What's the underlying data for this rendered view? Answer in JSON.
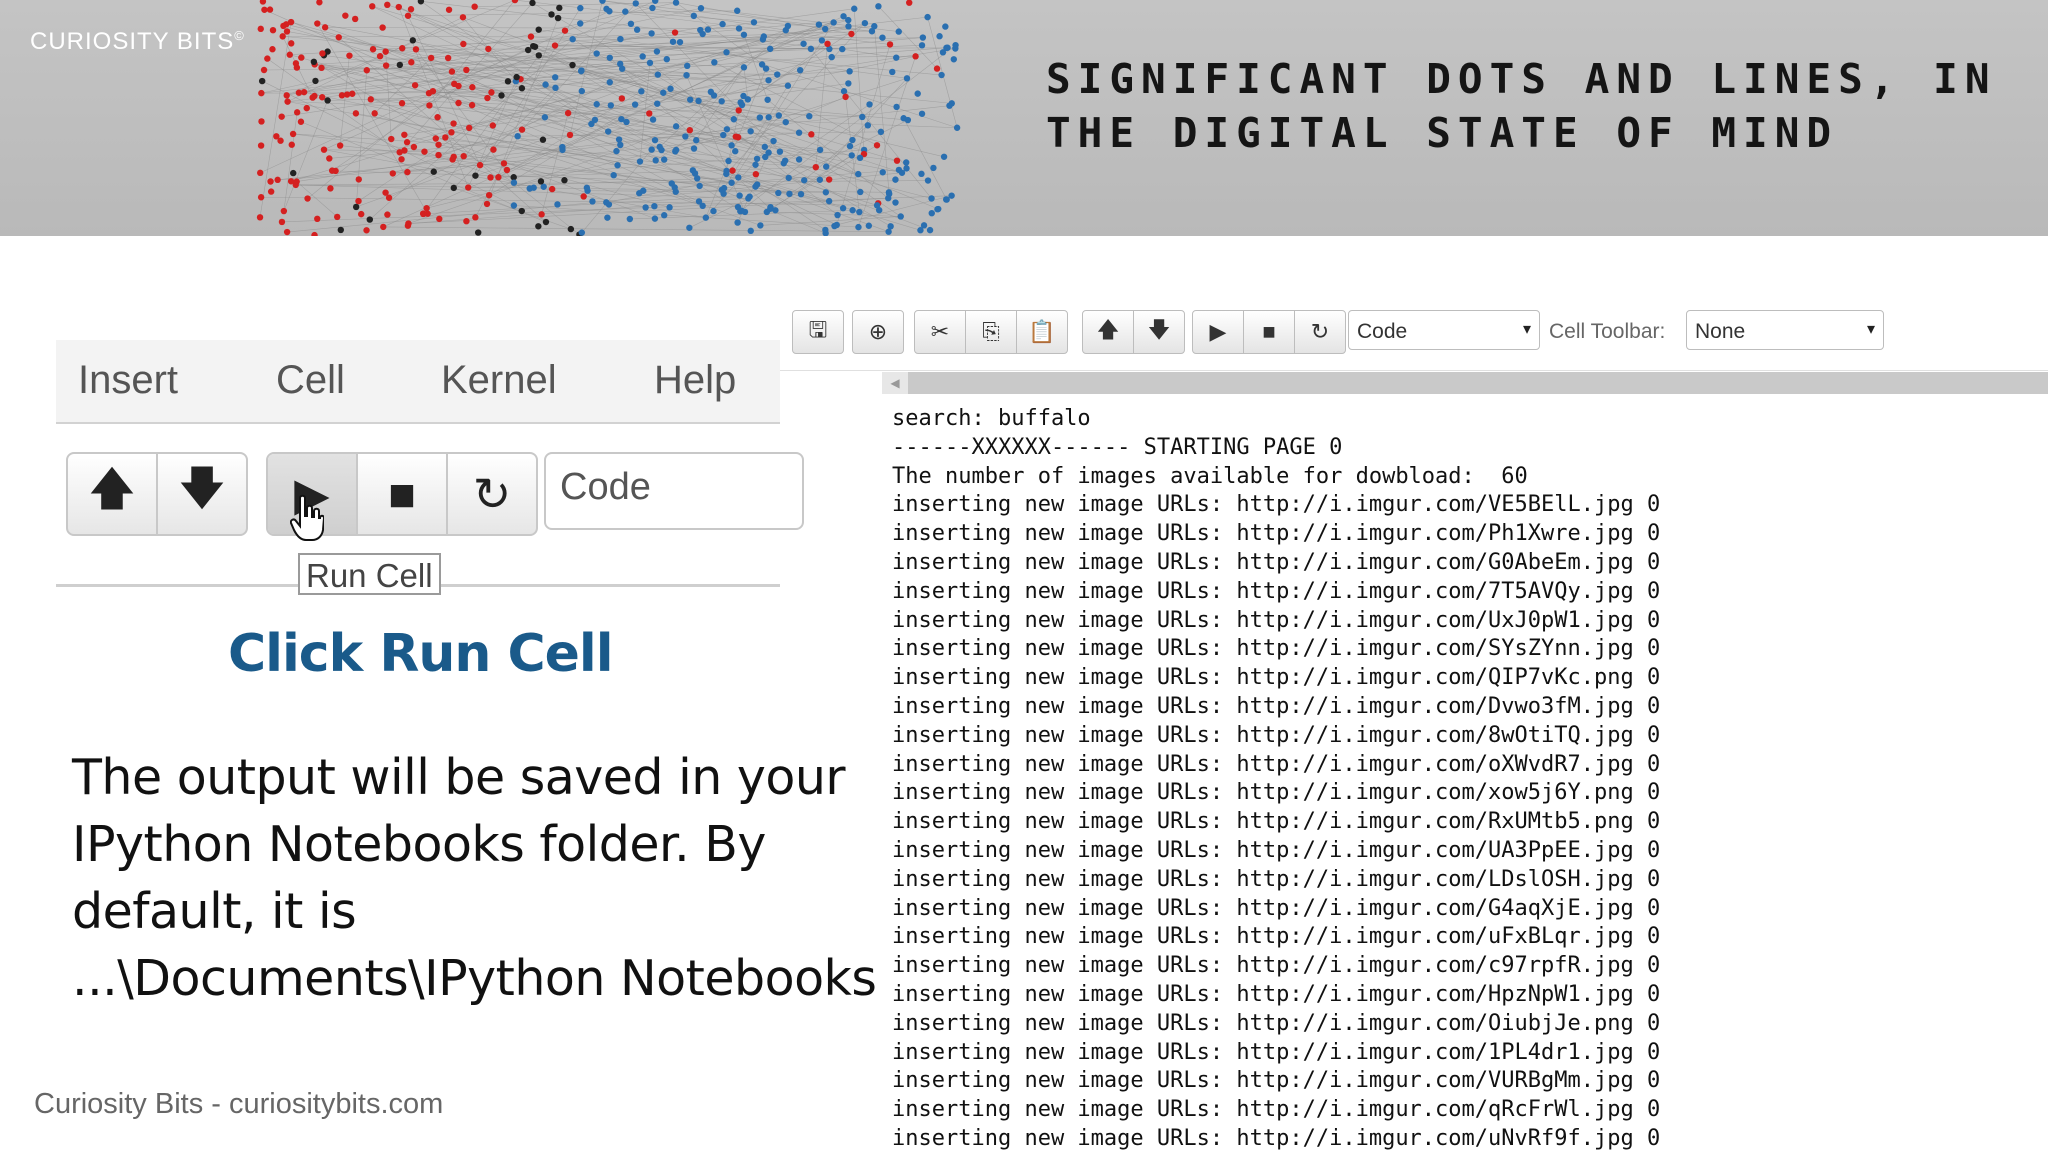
{
  "banner": {
    "brand": "CURIOSITY BITS",
    "brand_mark": "©",
    "tagline_line1": "SIGNIFICANT DOTS AND LINES, IN",
    "tagline_line2": "THE DIGITAL STATE OF MIND"
  },
  "zoom_menu": {
    "items": [
      "Insert",
      "Cell",
      "Kernel",
      "Help"
    ]
  },
  "zoom_toolbar": {
    "cell_type": "Code",
    "tooltip": "Run Cell"
  },
  "instructions": {
    "heading": "Click Run Cell",
    "line1": "The output will be saved in your",
    "line2": "IPython Notebooks folder. By",
    "line3": "default, it is",
    "line4": "...\\Documents\\IPython Notebooks"
  },
  "footer": "Curiosity Bits - curiositybits.com",
  "notebook_toolbar": {
    "cell_type": "Code",
    "cell_toolbar_label": "Cell Toolbar:",
    "cell_toolbar_value": "None"
  },
  "output_lines": [
    "search: buffalo",
    "------XXXXXX------ STARTING PAGE 0",
    "The number of images available for dowbload:  60",
    "inserting new image URLs: http://i.imgur.com/VE5BElL.jpg 0",
    "inserting new image URLs: http://i.imgur.com/Ph1Xwre.jpg 0",
    "inserting new image URLs: http://i.imgur.com/G0AbeEm.jpg 0",
    "inserting new image URLs: http://i.imgur.com/7T5AVQy.jpg 0",
    "inserting new image URLs: http://i.imgur.com/UxJ0pW1.jpg 0",
    "inserting new image URLs: http://i.imgur.com/SYsZYnn.jpg 0",
    "inserting new image URLs: http://i.imgur.com/QIP7vKc.png 0",
    "inserting new image URLs: http://i.imgur.com/Dvwo3fM.jpg 0",
    "inserting new image URLs: http://i.imgur.com/8wOtiTQ.jpg 0",
    "inserting new image URLs: http://i.imgur.com/oXWvdR7.jpg 0",
    "inserting new image URLs: http://i.imgur.com/xow5j6Y.png 0",
    "inserting new image URLs: http://i.imgur.com/RxUMtb5.png 0",
    "inserting new image URLs: http://i.imgur.com/UA3PpEE.jpg 0",
    "inserting new image URLs: http://i.imgur.com/LDslOSH.jpg 0",
    "inserting new image URLs: http://i.imgur.com/G4aqXjE.jpg 0",
    "inserting new image URLs: http://i.imgur.com/uFxBLqr.jpg 0",
    "inserting new image URLs: http://i.imgur.com/c97rpfR.jpg 0",
    "inserting new image URLs: http://i.imgur.com/HpzNpW1.jpg 0",
    "inserting new image URLs: http://i.imgur.com/OiubjJe.png 0",
    "inserting new image URLs: http://i.imgur.com/1PL4dr1.jpg 0",
    "inserting new image URLs: http://i.imgur.com/VURBgMm.jpg 0",
    "inserting new image URLs: http://i.imgur.com/qRcFrWl.jpg 0",
    "inserting new image URLs: http://i.imgur.com/uNvRf9f.jpg 0"
  ],
  "colors": {
    "network_red": "#d42020",
    "network_blue": "#2a6fb0",
    "heading_blue": "#1a5a8a"
  }
}
